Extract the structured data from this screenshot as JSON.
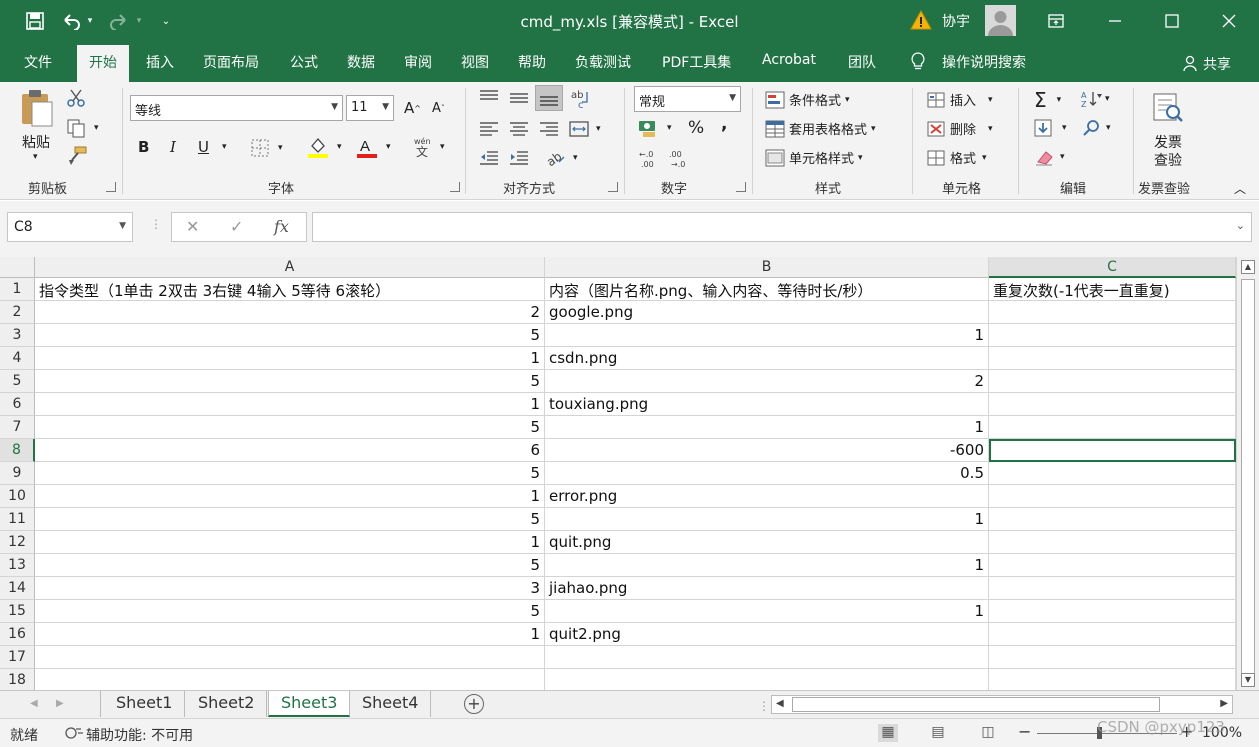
{
  "title_bar": {
    "title": "cmd_my.xls  [兼容模式]  -  Excel",
    "user": "协宇"
  },
  "menu": {
    "tabs": [
      "文件",
      "开始",
      "插入",
      "页面布局",
      "公式",
      "数据",
      "审阅",
      "视图",
      "帮助",
      "负载测试",
      "PDF工具集",
      "Acrobat",
      "团队"
    ],
    "search": "操作说明搜索",
    "share": "共享"
  },
  "ribbon": {
    "clipboard": {
      "paste": "粘贴",
      "label": "剪贴板"
    },
    "font": {
      "name": "等线",
      "size": "11",
      "bold": "B",
      "italic": "I",
      "underline": "U",
      "label": "字体"
    },
    "alignment": {
      "label": "对齐方式"
    },
    "number": {
      "format": "常规",
      "percent": "%",
      "comma": ",",
      "label": "数字"
    },
    "styles": {
      "conditional": "条件格式",
      "table": "套用表格格式",
      "cell": "单元格样式",
      "label": "样式"
    },
    "cells": {
      "insert": "插入",
      "delete": "删除",
      "format": "格式",
      "label": "单元格"
    },
    "editing": {
      "label": "编辑"
    },
    "invoice": {
      "button_line1": "发票",
      "button_line2": "查验",
      "label": "发票查验"
    }
  },
  "formula_bar": {
    "name_box": "C8",
    "cancel": "✕",
    "enter": "✓",
    "fx": "fx",
    "content": ""
  },
  "sheet": {
    "columns": [
      "A",
      "B",
      "C"
    ],
    "rows": [
      {
        "n": "1",
        "a": "指令类型（1单击  2双击  3右键  4输入  5等待  6滚轮）",
        "b": "内容（图片名称.png、输入内容、等待时长/秒）",
        "c": "重复次数(-1代表一直重复)"
      },
      {
        "n": "2",
        "a": "2",
        "b": "google.png",
        "c": ""
      },
      {
        "n": "3",
        "a": "5",
        "b": "1",
        "c": ""
      },
      {
        "n": "4",
        "a": "1",
        "b": "csdn.png",
        "c": ""
      },
      {
        "n": "5",
        "a": "5",
        "b": "2",
        "c": ""
      },
      {
        "n": "6",
        "a": "1",
        "b": "touxiang.png",
        "c": ""
      },
      {
        "n": "7",
        "a": "5",
        "b": "1",
        "c": ""
      },
      {
        "n": "8",
        "a": "6",
        "b": "-600",
        "c": ""
      },
      {
        "n": "9",
        "a": "5",
        "b": "0.5",
        "c": ""
      },
      {
        "n": "10",
        "a": "1",
        "b": "error.png",
        "c": ""
      },
      {
        "n": "11",
        "a": "5",
        "b": "1",
        "c": ""
      },
      {
        "n": "12",
        "a": "1",
        "b": "quit.png",
        "c": ""
      },
      {
        "n": "13",
        "a": "5",
        "b": "1",
        "c": ""
      },
      {
        "n": "14",
        "a": "3",
        "b": "jiahao.png",
        "c": ""
      },
      {
        "n": "15",
        "a": "5",
        "b": "1",
        "c": ""
      },
      {
        "n": "16",
        "a": "1",
        "b": "quit2.png",
        "c": ""
      },
      {
        "n": "17",
        "a": "",
        "b": "",
        "c": ""
      },
      {
        "n": "18",
        "a": "",
        "b": "",
        "c": ""
      }
    ]
  },
  "sheet_tabs": [
    "Sheet1",
    "Sheet2",
    "Sheet3",
    "Sheet4"
  ],
  "active_sheet": "Sheet3",
  "status_bar": {
    "mode": "就绪",
    "accessibility": "辅助功能: 不可用",
    "zoom": "100%"
  },
  "watermark": "CSDN @pxyp123",
  "colors": {
    "accent": "#217346",
    "font_color_bar": "#e0201b",
    "fill_color_bar": "#ffff00"
  }
}
